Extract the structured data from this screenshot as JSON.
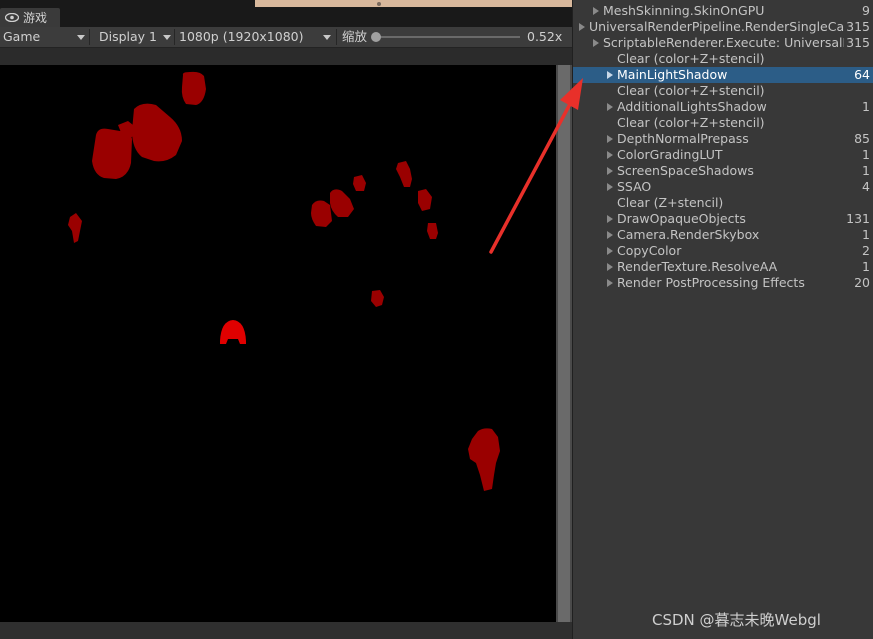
{
  "game_tab": {
    "label": "游戏",
    "icon": "eye-icon"
  },
  "toolbar": {
    "view_select": "Game",
    "display_select": "Display 1",
    "resolution_select": "1080p (1920x1080)",
    "scale_label": "缩放",
    "scale_value": "0.52x",
    "scale_fraction": 0.0
  },
  "tree": {
    "rows": [
      {
        "indent": 1,
        "expandable": true,
        "name": "MeshSkinning.SkinOnGPU",
        "count": "9"
      },
      {
        "indent": 0,
        "expandable": true,
        "name": "UniversalRenderPipeline.RenderSingleCamera",
        "count": "315"
      },
      {
        "indent": 1,
        "expandable": true,
        "name": "ScriptableRenderer.Execute: UniversalRenderer",
        "count": "315"
      },
      {
        "indent": 2,
        "expandable": false,
        "name": "Clear (color+Z+stencil)",
        "count": ""
      },
      {
        "indent": 2,
        "expandable": true,
        "name": "MainLightShadow",
        "count": "64",
        "selected": true
      },
      {
        "indent": 2,
        "expandable": false,
        "name": "Clear (color+Z+stencil)",
        "count": ""
      },
      {
        "indent": 2,
        "expandable": true,
        "name": "AdditionalLightsShadow",
        "count": "1"
      },
      {
        "indent": 2,
        "expandable": false,
        "name": "Clear (color+Z+stencil)",
        "count": ""
      },
      {
        "indent": 2,
        "expandable": true,
        "name": "DepthNormalPrepass",
        "count": "85"
      },
      {
        "indent": 2,
        "expandable": true,
        "name": "ColorGradingLUT",
        "count": "1"
      },
      {
        "indent": 2,
        "expandable": true,
        "name": "ScreenSpaceShadows",
        "count": "1"
      },
      {
        "indent": 2,
        "expandable": true,
        "name": "SSAO",
        "count": "4"
      },
      {
        "indent": 2,
        "expandable": false,
        "name": "Clear (Z+stencil)",
        "count": ""
      },
      {
        "indent": 2,
        "expandable": true,
        "name": "DrawOpaqueObjects",
        "count": "131"
      },
      {
        "indent": 2,
        "expandable": true,
        "name": "Camera.RenderSkybox",
        "count": "1"
      },
      {
        "indent": 2,
        "expandable": true,
        "name": "CopyColor",
        "count": "2"
      },
      {
        "indent": 2,
        "expandable": true,
        "name": "RenderTexture.ResolveAA",
        "count": "1"
      },
      {
        "indent": 2,
        "expandable": true,
        "name": "Render PostProcessing Effects",
        "count": "20"
      }
    ]
  },
  "watermark": "CSDN @暮志未晚Webgl",
  "colors": {
    "selection": "#2c5d87",
    "shadow_red": "#b00000",
    "annotation_arrow": "#e8302a"
  }
}
